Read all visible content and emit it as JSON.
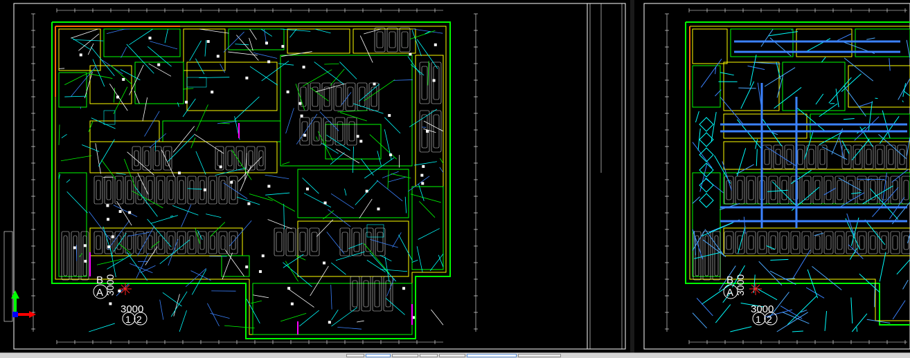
{
  "sheet_left": {
    "axis_letter_b": "B",
    "axis_letter_a": "A",
    "dim_vertical": "3000",
    "dim_horizontal": "3000",
    "axis_num_1": "1",
    "axis_num_2": "2"
  },
  "sheet_right": {
    "axis_letter_b": "B",
    "axis_letter_a": "A",
    "dim_vertical": "3000",
    "dim_horizontal": "3000",
    "axis_num_1": "1",
    "axis_num_2": "2"
  },
  "colors": {
    "background": "#000000",
    "frame": "#ffffff",
    "walls_green": "#00ff00",
    "walls_yellow": "#ffff00",
    "wiring_cyan": "#00ffff",
    "wiring_blue": "#3b82ff",
    "magenta": "#ff00ff",
    "red": "#ff2020",
    "ucs_green": "#00ff00",
    "ucs_red": "#ff0000",
    "ucs_blue": "#0000ff"
  },
  "icons": [
    "ucs-axis-icon",
    "ucs-origin-marker"
  ]
}
